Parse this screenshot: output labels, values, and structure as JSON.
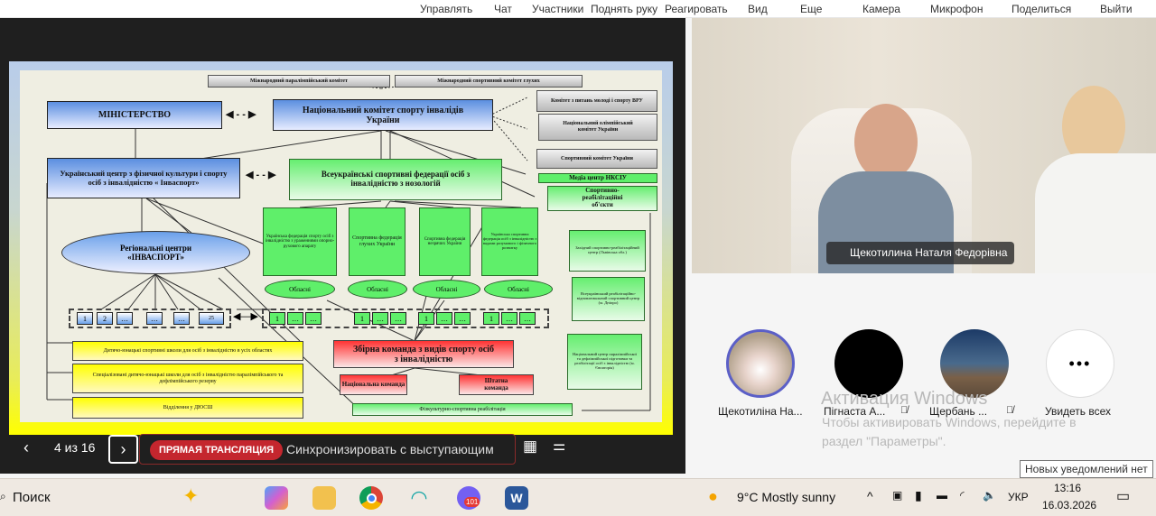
{
  "toolbar": [
    "Управлять",
    "Чат",
    "Участники",
    "Поднять руку",
    "Реагировать",
    "Вид",
    "Еще",
    "Камера",
    "Микрофон",
    "Поделиться",
    "Выйти"
  ],
  "slide": {
    "intl_paralympic": "Міжнародний паралімпійський комітет",
    "intl_deaf": "Міжнародний спортивний комітет глухих",
    "ministry": "МІНІСТЕРСТВО",
    "national_committee": "Національний комітет спорту інвалідів України",
    "youth_committee": "Комітет з питань молоді і спорту ВРУ",
    "olympic_committee": "Національний олімпійський комітет України",
    "sport_committee": "Спортивний комітет України",
    "media_centre": "Медіа центр НКСІУ",
    "rehab_objects": "Спортивно-реабілітаційні об'єкти",
    "invasport_centre": "Український центр з фізичної культури і спорту осіб з інвалідністю « Інваспорт»",
    "federations": "Всеукраїнські спортивні федерації осіб з інвалідністю з нозологій",
    "regional": "Регіональні центри «ІНВАСПОРТ»",
    "fed1": "Українська федерація спорту осіб з інвалідністю з ураженнями опорно-рухового апарату",
    "fed2": "Спортивна федерація глухих України",
    "fed3": "Спортивна федерація незрячих України",
    "fed4": "Українська спортивна федерація осіб з інвалідністю з вадами розумового і фізичного розвитку",
    "oblasni": "Обласні",
    "left_squares": [
      "1",
      "2",
      "…",
      "…",
      "…",
      "25"
    ],
    "right_squares": [
      "1",
      "…",
      "…",
      "1",
      "…",
      "…",
      "1",
      "…",
      "…",
      "1",
      "…",
      "…"
    ],
    "school1": "Дитячо-юнацькі спортивні школи для осіб з інвалідністю в усіх областях",
    "school2": "Спеціалізовані дитячо-юнацькі школи для осіб з інвалідністю паралімпійського та дефлімпійського резерву",
    "school3": "Відділення у ДЮСШ",
    "team": "Збірна команда з видів спорту осіб з інвалідністю",
    "national_team": "Національна команда",
    "staff_team": "Штатна команда",
    "rehab": "Фізкультурно-спортивна реабілітація",
    "west_centre": "Західний спортивно-реабілітаційний центр (Львівська обл.)",
    "dnipro_centre": "Всеукраїнський реабілітаційно-відновлювальний спортивний центр (м. Дніпро)",
    "evpatoria_centre": "Національний центр паралімпійської та дефлімпійської підготовки та реабілітації осіб з інвалідністю (м. Євпаторія)"
  },
  "controls": {
    "page": "4 из 16",
    "live": "ПРЯМАЯ ТРАНСЛЯЦИЯ",
    "sync": "Синхронизировать с выступающим"
  },
  "video": {
    "speaker": "Щекотилина Наталя Федорівна"
  },
  "participants": [
    {
      "name": "Щекотиліна На..."
    },
    {
      "name": "Пігнаста А..."
    },
    {
      "name": "Щербань ..."
    },
    {
      "name": "Увидеть всех"
    }
  ],
  "watermark": {
    "title": "Активация Windows",
    "text": "Чтобы активировать Windows, перейдите в раздел \"Параметры\"."
  },
  "tooltip": "Новых уведомлений нет",
  "taskbar": {
    "search": "Поиск",
    "weather": "9°C  Mostly sunny",
    "lang": "УКР",
    "time": "13:16",
    "date": "16.03.2026",
    "badge": "101"
  }
}
